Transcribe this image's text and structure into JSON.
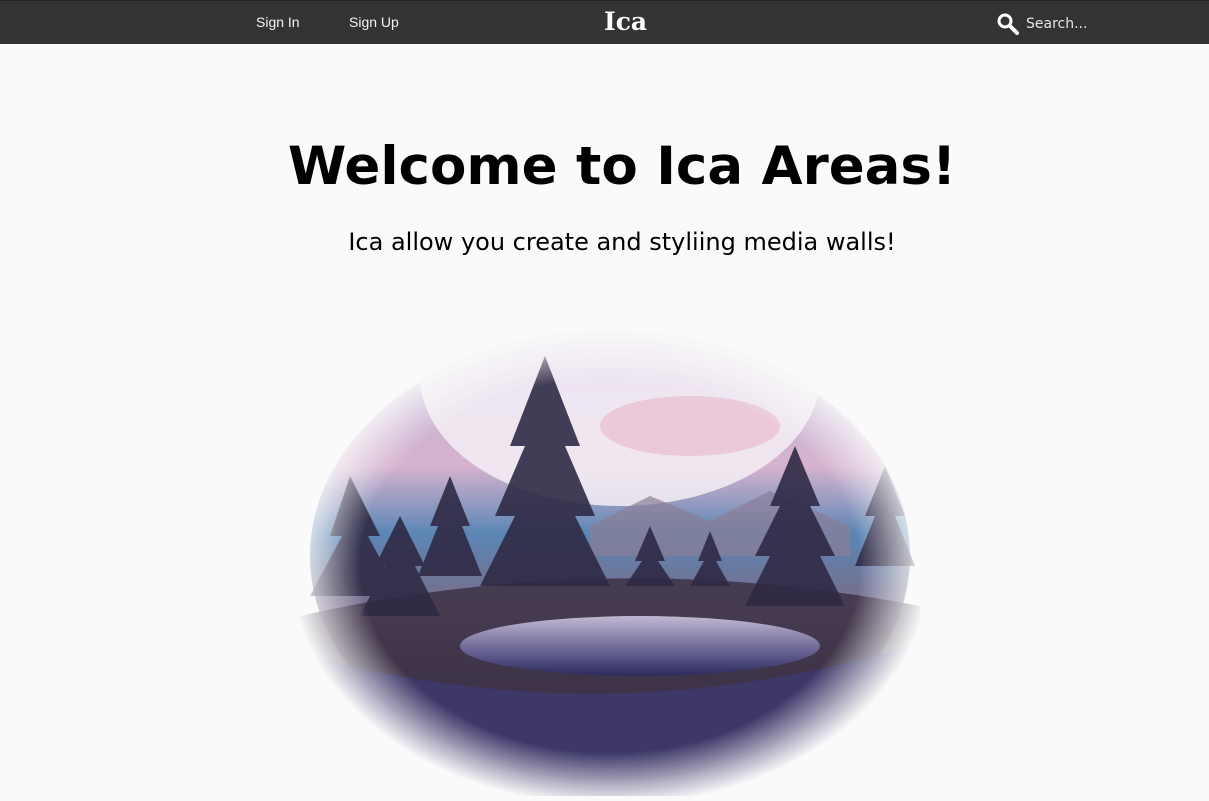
{
  "nav": {
    "sign_in": "Sign In",
    "sign_up": "Sign Up",
    "brand": "Ica"
  },
  "search": {
    "placeholder": "Search...",
    "icon": "search-icon",
    "value": ""
  },
  "hero": {
    "title": "Welcome to Ica Areas!",
    "subtitle": "Ica allow you create and styliing media walls!",
    "image_subject": "misty lake with pine trees in an oval vignette"
  },
  "colors": {
    "topbar": "#333333",
    "page_background": "#fafafa",
    "text": "#000000",
    "nav_text": "#f1f1f1"
  }
}
